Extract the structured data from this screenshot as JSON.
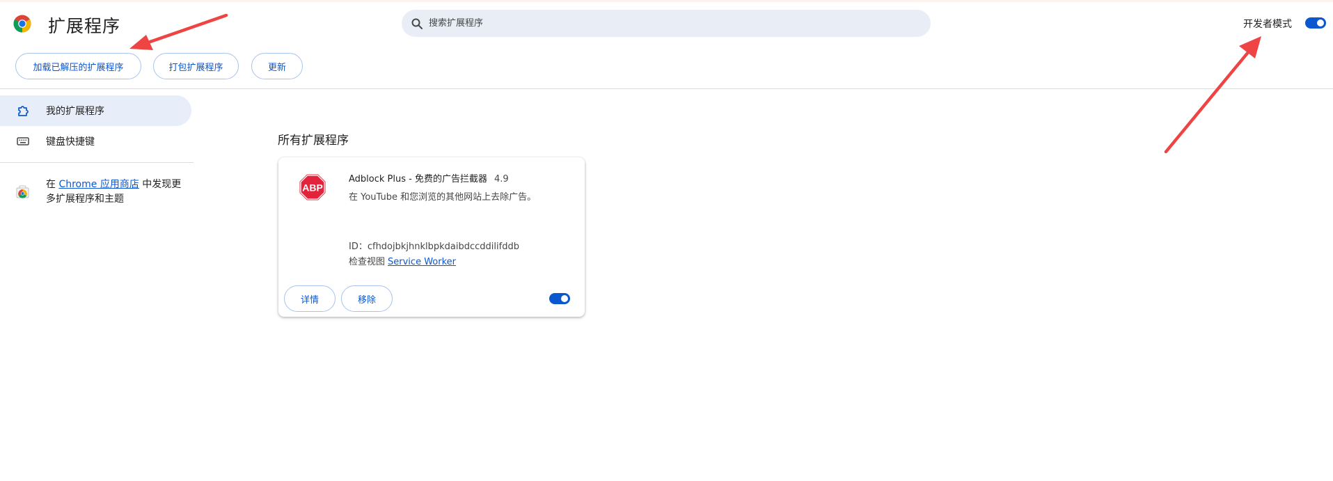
{
  "header": {
    "title": "扩展程序",
    "search_placeholder": "搜索扩展程序",
    "dev_mode_label": "开发者模式",
    "dev_mode_enabled": true
  },
  "toolbar": {
    "load_unpacked": "加载已解压的扩展程序",
    "pack": "打包扩展程序",
    "update": "更新"
  },
  "sidebar": {
    "items": [
      {
        "label": "我的扩展程序",
        "icon": "puzzle-icon",
        "active": true
      },
      {
        "label": "键盘快捷键",
        "icon": "keyboard-icon",
        "active": false
      }
    ],
    "store_prefix": "在",
    "store_link": "Chrome 应用商店",
    "store_suffix": "中发现更多扩展程序和主题"
  },
  "main": {
    "section_title": "所有扩展程序",
    "extensions": [
      {
        "name": "Adblock Plus - 免费的广告拦截器",
        "version": "4.9",
        "description": "在 YouTube 和您浏览的其他网站上去除广告。",
        "id_line": "ID：cfhdojbkjhnklbpkdaibdccddilifddb",
        "inspect_label": "检查视图",
        "inspect_link": "Service Worker",
        "details_label": "详情",
        "remove_label": "移除",
        "enabled": true,
        "icon": "abp-icon",
        "icon_text": "ABP"
      }
    ]
  },
  "colors": {
    "accent": "#0b57d0",
    "search_bg": "#e9eef6",
    "active_nav_bg": "#e8eef9",
    "abp_red": "#e3233b"
  }
}
